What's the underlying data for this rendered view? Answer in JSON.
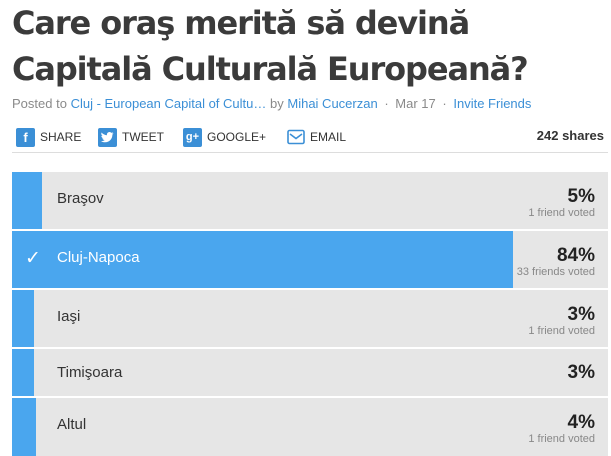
{
  "poll": {
    "title": "Care oraş merită să devină Capitală Culturală Europeană?",
    "meta": {
      "posted_to_prefix": "Posted to",
      "category": "Cluj - European Capital of Cultu…",
      "by_prefix": "by",
      "author": "Mihai Cucerzan",
      "date": "Mar 17",
      "invite": "Invite Friends"
    }
  },
  "share": {
    "facebook": {
      "icon": "facebook-icon",
      "label": "SHARE"
    },
    "twitter": {
      "icon": "twitter-icon",
      "label": "TWEET"
    },
    "google": {
      "icon": "google-plus-icon",
      "label": "GOOGLE+"
    },
    "email": {
      "icon": "email-icon",
      "label": "EMAIL"
    },
    "count": "242 shares"
  },
  "options": [
    {
      "label": "Braşov",
      "percent": "5%",
      "share": 0.05,
      "friends": "1 friend voted",
      "selected": false
    },
    {
      "label": "Cluj-Napoca",
      "percent": "84%",
      "share": 0.84,
      "friends": "33 friends voted",
      "selected": true
    },
    {
      "label": "Iaşi",
      "percent": "3%",
      "share": 0.03,
      "friends": "1 friend voted",
      "selected": false
    },
    {
      "label": "Timişoara",
      "percent": "3%",
      "share": 0.03,
      "friends": "",
      "selected": false
    },
    {
      "label": "Altul",
      "percent": "4%",
      "share": 0.04,
      "friends": "1 friend voted",
      "selected": false
    }
  ],
  "colors": {
    "accent": "#4aa6ee",
    "link": "#3b8fd6",
    "option_bg": "#e6e6e6"
  }
}
